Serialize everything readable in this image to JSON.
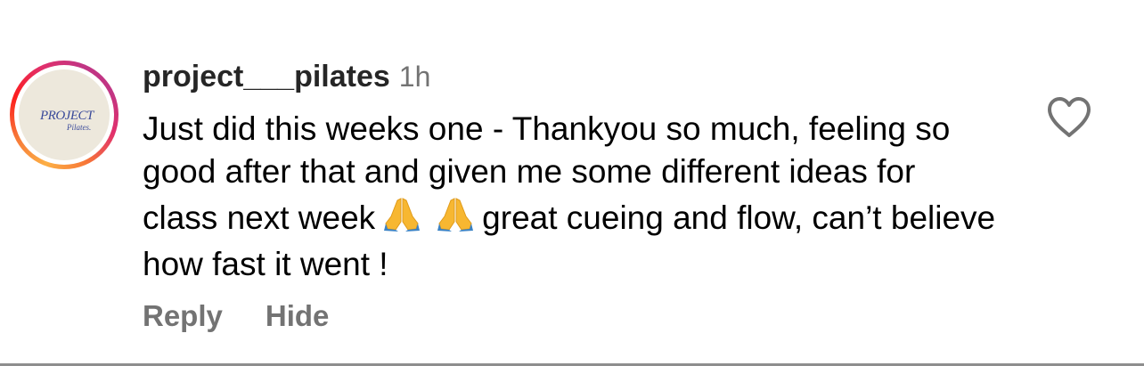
{
  "avatar": {
    "logo_main": "PROJECT",
    "logo_sub": "Pilates."
  },
  "comment": {
    "username": "project___pilates",
    "time": "1h",
    "text_part1": "Just did this weeks one - Thankyou so much, feeling so good after that and given me some different ideas for class next week",
    "text_part2": "great cueing and flow, can’t believe how fast it went !",
    "emojis": [
      "folded-hands-emoji",
      "folded-hands-emoji"
    ]
  },
  "actions": {
    "reply_label": "Reply",
    "hide_label": "Hide"
  },
  "icons": {
    "like": "heart-icon"
  },
  "colors": {
    "username": "#262626",
    "secondary_text": "#737373",
    "avatar_bg": "#ede8dc",
    "logo": "#3a4a9a"
  }
}
